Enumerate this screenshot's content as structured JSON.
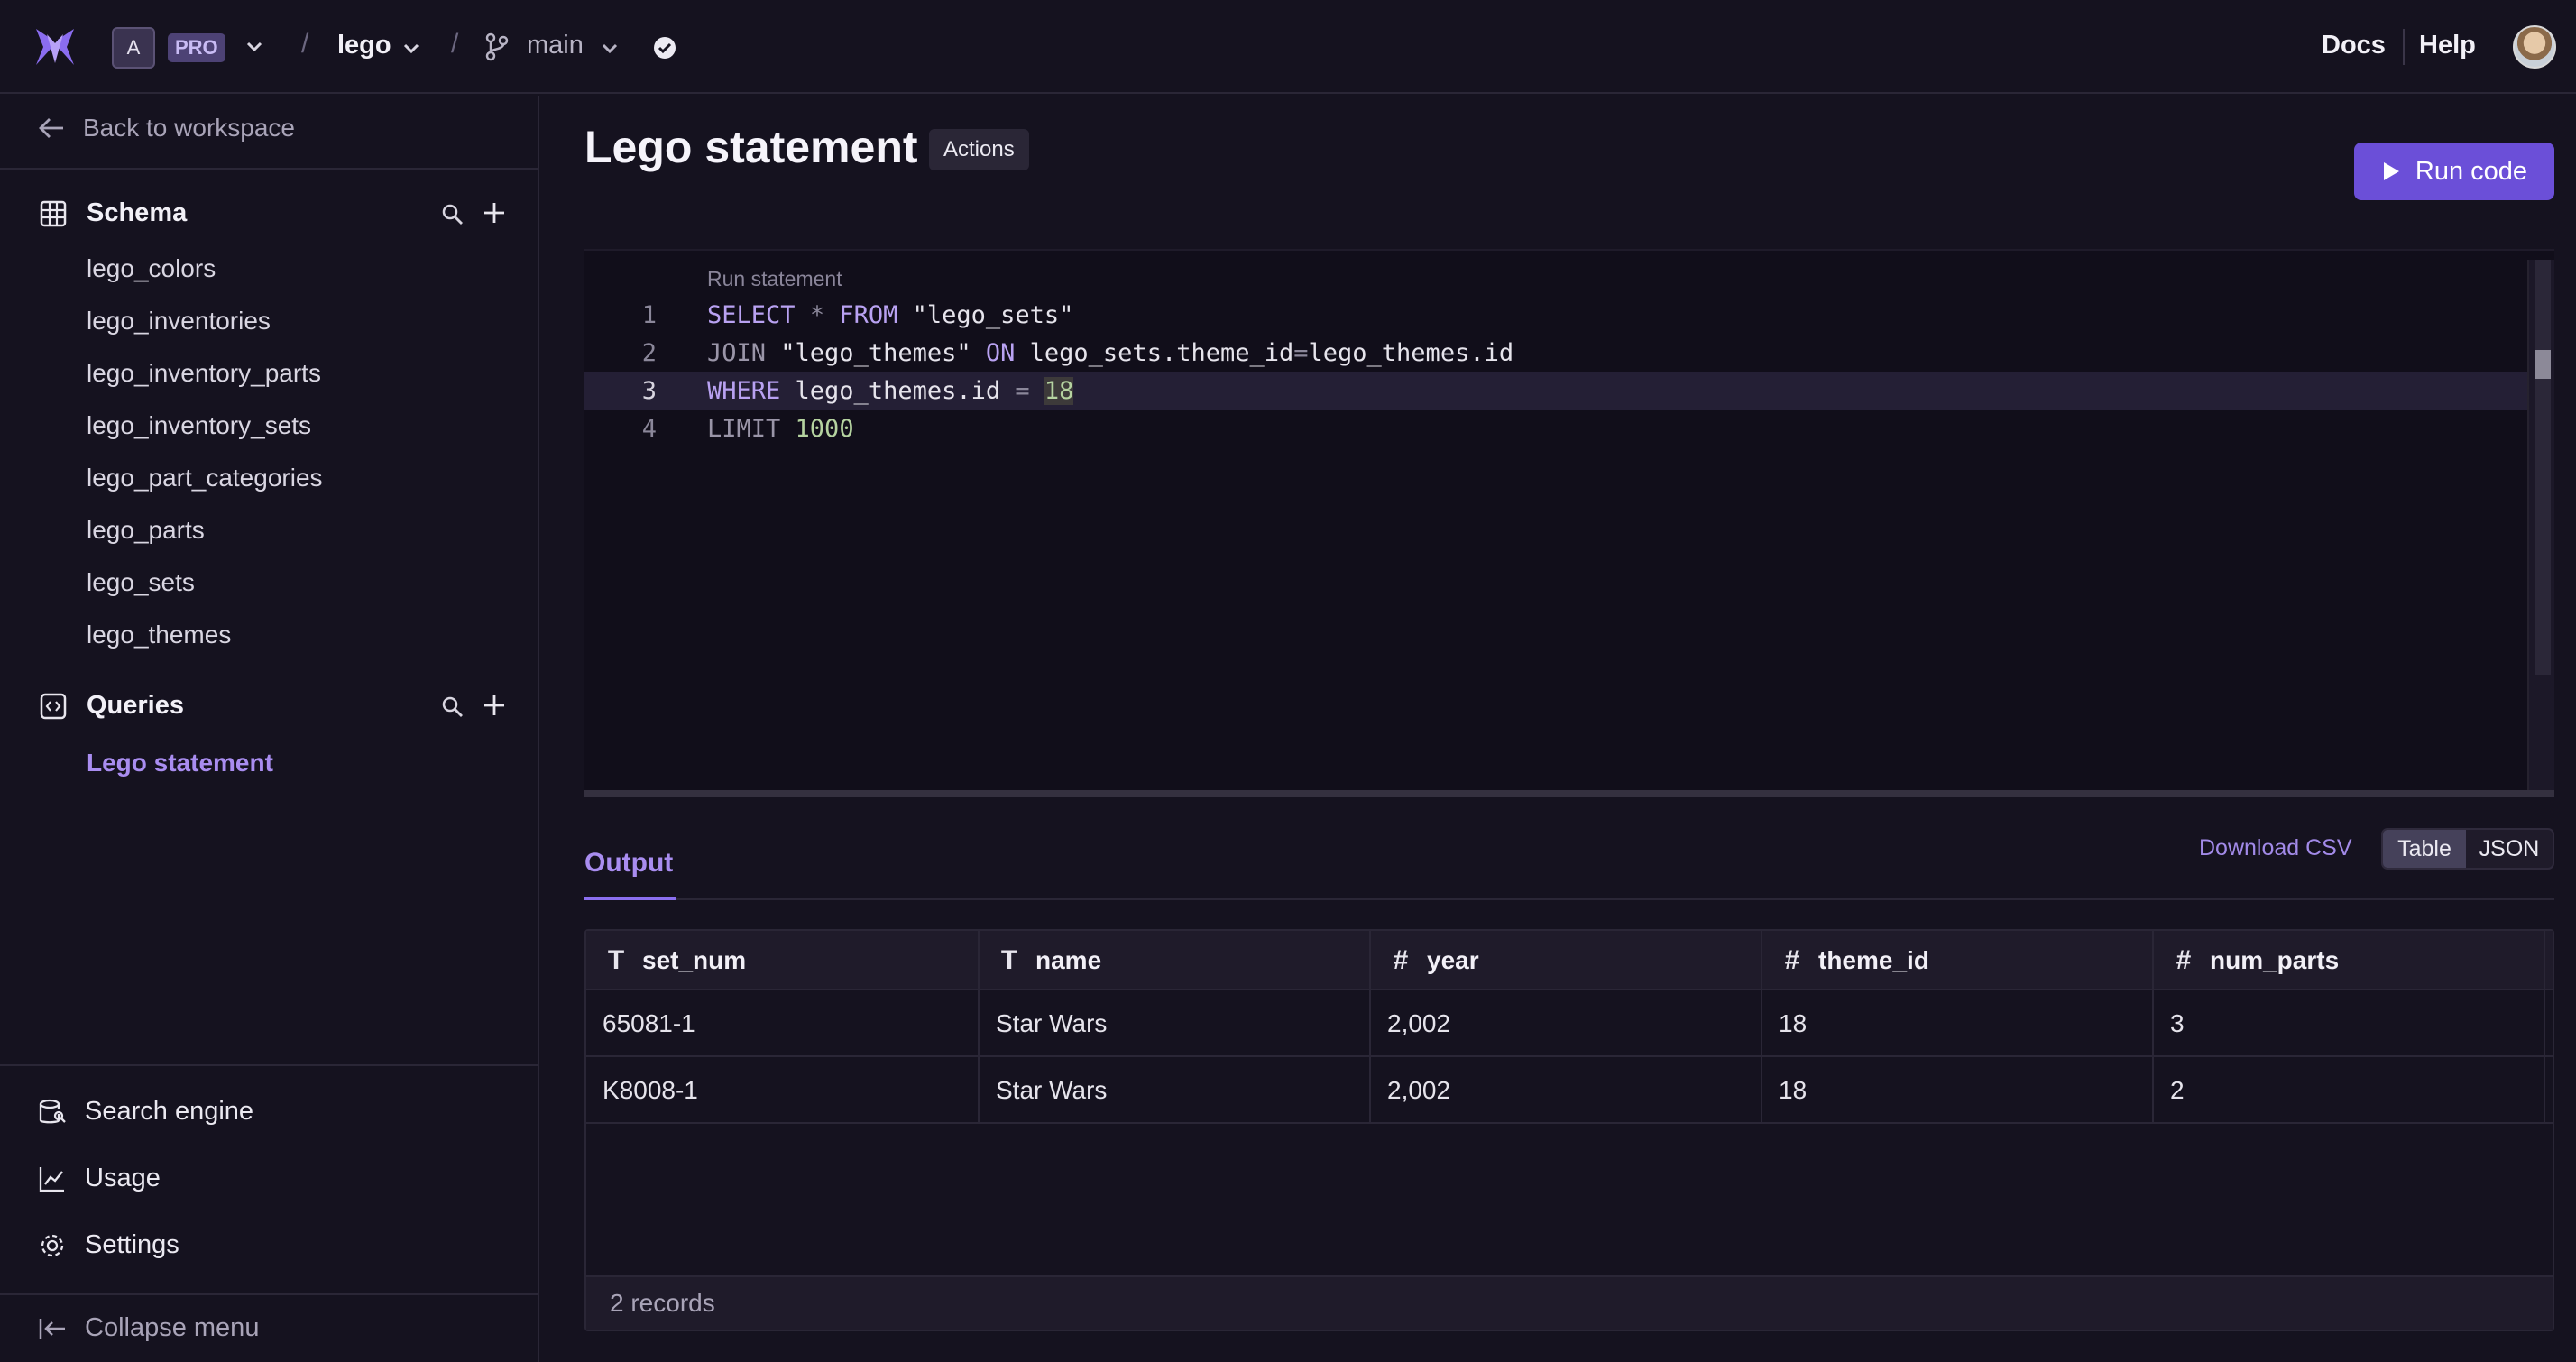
{
  "header": {
    "workspace_initial": "A",
    "plan_badge": "PRO",
    "separator": "/",
    "project": "lego",
    "branch": "main",
    "docs_label": "Docs",
    "help_label": "Help"
  },
  "sidebar": {
    "back_label": "Back to workspace",
    "schema": {
      "title": "Schema",
      "tables": [
        "lego_colors",
        "lego_inventories",
        "lego_inventory_parts",
        "lego_inventory_sets",
        "lego_part_categories",
        "lego_parts",
        "lego_sets",
        "lego_themes"
      ]
    },
    "queries": {
      "title": "Queries",
      "items": [
        "Lego statement"
      ]
    },
    "bottom": {
      "search_engine": "Search engine",
      "usage": "Usage",
      "settings": "Settings",
      "collapse": "Collapse menu"
    }
  },
  "main": {
    "title": "Lego statement",
    "actions_label": "Actions",
    "run_label": "Run code",
    "editor": {
      "run_hint": "Run statement",
      "line_numbers": [
        "1",
        "2",
        "3",
        "4"
      ],
      "current_line": 3
    },
    "output": {
      "tab_label": "Output",
      "download_label": "Download CSV",
      "view_table": "Table",
      "view_json": "JSON",
      "columns": [
        {
          "type_icon": "T",
          "name": "set_num"
        },
        {
          "type_icon": "T",
          "name": "name"
        },
        {
          "type_icon": "#",
          "name": "year"
        },
        {
          "type_icon": "#",
          "name": "theme_id"
        },
        {
          "type_icon": "#",
          "name": "num_parts"
        }
      ],
      "rows": [
        [
          "65081-1",
          "Star Wars",
          "2,002",
          "18",
          "3"
        ],
        [
          "K8008-1",
          "Star Wars",
          "2,002",
          "18",
          "2"
        ]
      ],
      "records_label": "2 records"
    }
  },
  "colors": {
    "background": "#15121f",
    "accent": "#6b4fd8",
    "accent_text": "#a98df0"
  }
}
